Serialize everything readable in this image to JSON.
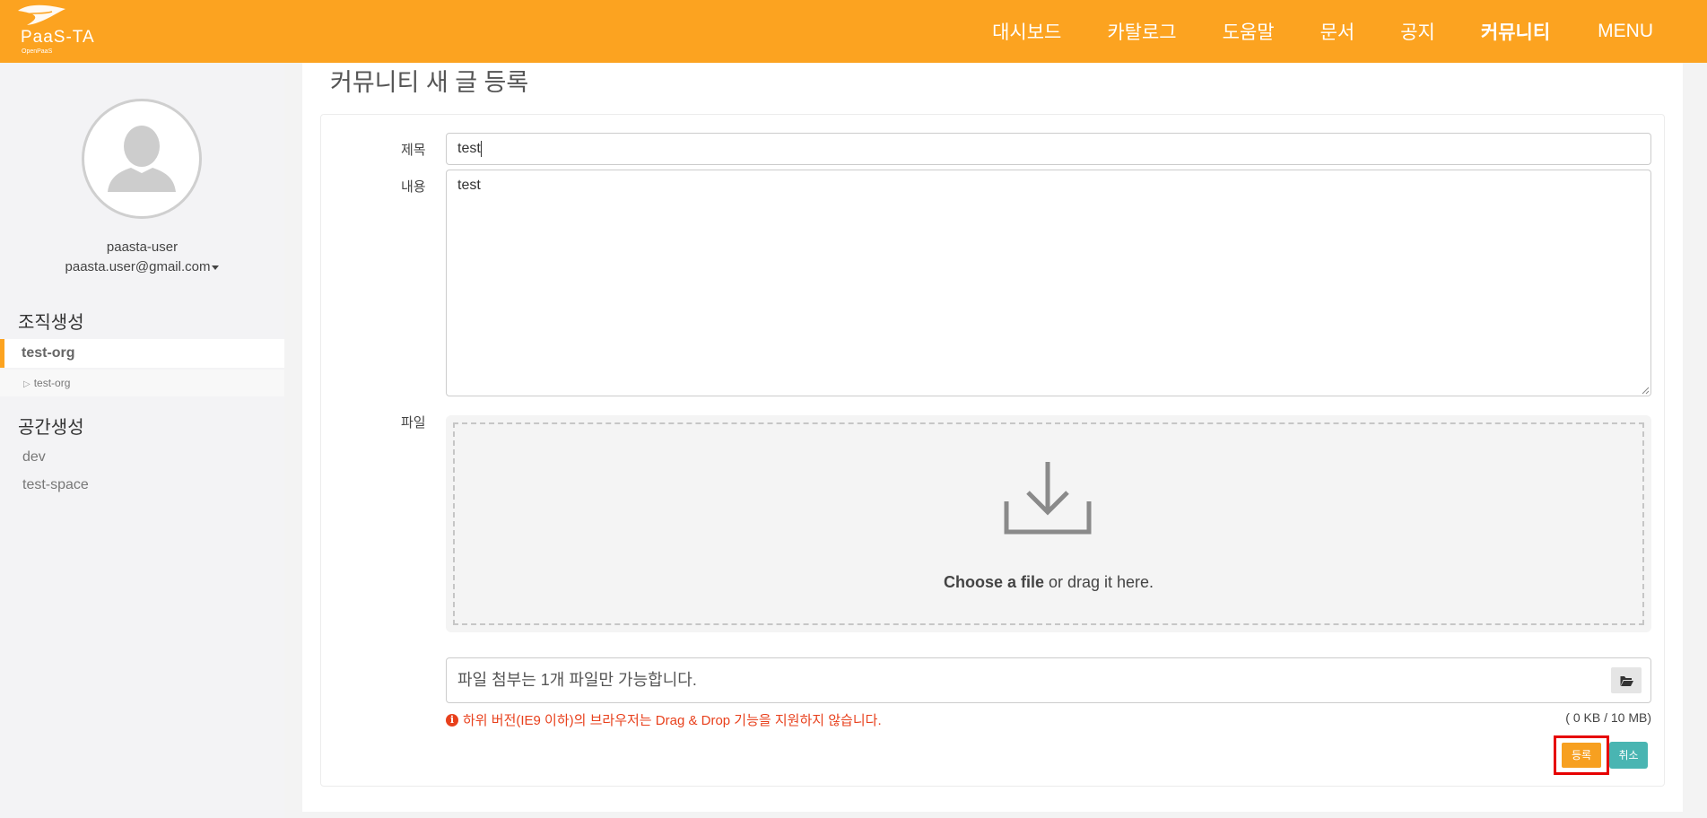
{
  "header": {
    "logo_text": "PaaS-TA",
    "logo_sub": "OpenPaaS",
    "nav": [
      "대시보드",
      "카탈로그",
      "도움말",
      "문서",
      "공지",
      "커뮤니티"
    ],
    "menu_label": "MENU",
    "bg_color": "#fca320"
  },
  "sidebar": {
    "user_name": "paasta-user",
    "user_email": "paasta.user@gmail.com",
    "org_section_title": "조직생성",
    "org_selected": "test-org",
    "org_sub_item": "test-org",
    "space_section_title": "공간생성",
    "spaces": [
      "dev",
      "test-space"
    ]
  },
  "page": {
    "title": "커뮤니티 새 글 등록"
  },
  "form": {
    "title_label": "제목",
    "title_value": "test",
    "content_label": "내용",
    "content_value": "test",
    "file_label": "파일",
    "dropzone_bold": "Choose a file",
    "dropzone_rest": " or drag it here.",
    "file_field_text": "파일 첨부는 1개 파일만 가능합니다.",
    "warning_text": "하위 버전(IE9 이하)의 브라우저는 Drag & Drop 기능을 지원하지 않습니다.",
    "size_text": "( 0 KB / 10 MB)",
    "submit_label": "등록",
    "cancel_label": "취소"
  },
  "icons": {
    "avatar": "user-silhouette-icon",
    "dropzone": "download-icon",
    "file_browse": "folder-open-icon",
    "warning": "info-circle-icon"
  }
}
